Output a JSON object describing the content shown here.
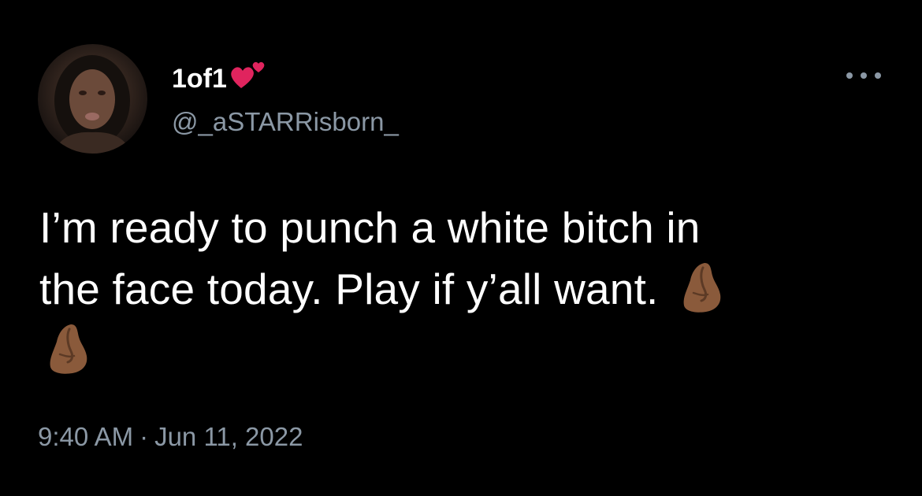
{
  "user": {
    "display_name": "1of1",
    "handle": "@_aSTARRisborn_",
    "name_emoji": "red-hearts-icon"
  },
  "tweet": {
    "line1": "I’m ready to punch a white bitch in",
    "line2": "the face today. Play if y’all want.",
    "trailing_emoji": "pinched-fingers-icon",
    "trailing_emoji_count": 2
  },
  "meta": {
    "time": "9:40 AM",
    "separator": "·",
    "date": "Jun 11, 2022"
  },
  "colors": {
    "background": "#000000",
    "text_primary": "#ffffff",
    "text_secondary": "#8b98a5",
    "heart": "#e0245e",
    "emoji_skin": "#8a5a3b"
  }
}
